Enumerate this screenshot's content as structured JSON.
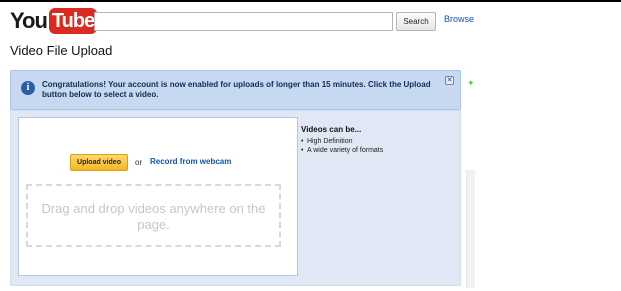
{
  "header": {
    "logo_you": "You",
    "logo_tube": "Tube",
    "search_placeholder": "",
    "search_button_label": "Search",
    "browse_label": "Browse"
  },
  "page_title": "Video File Upload",
  "notice": {
    "message": "Congratulations! Your account is now enabled for uploads of longer than 15 minutes. Click the Upload button below to select a video."
  },
  "upload": {
    "upload_button_label": "Upload video",
    "or_text": "or",
    "webcam_link_label": "Record from webcam",
    "dropzone_text": "Drag and drop videos anywhere on the page."
  },
  "formats": {
    "heading": "Videos can be...",
    "items": [
      "High Definition",
      "A wide variety of formats"
    ]
  },
  "colors": {
    "brand_red": "#d92b20",
    "notice_bg": "#c6d9f1",
    "upload_button": "#f2b822",
    "link": "#1155aa"
  }
}
